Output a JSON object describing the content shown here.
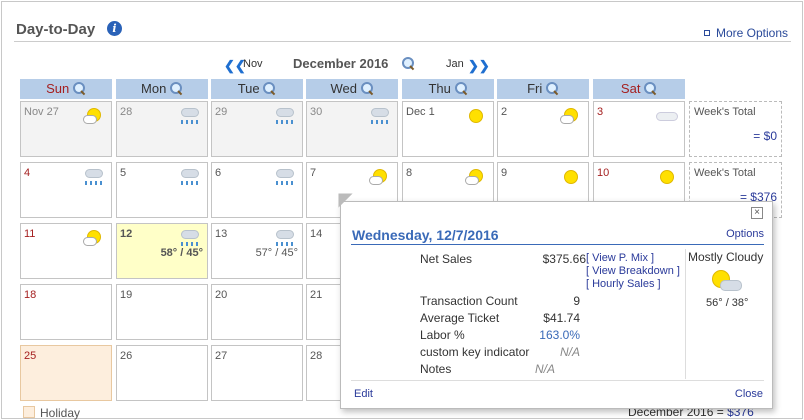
{
  "header": {
    "title": "Day-to-Day",
    "more_options": "More Options"
  },
  "nav": {
    "prev_label": "Nov",
    "month": "December 2016",
    "next_label": "Jan"
  },
  "day_headers": [
    "Sun",
    "Mon",
    "Tue",
    "Wed",
    "Thu",
    "Fri",
    "Sat"
  ],
  "cells": {
    "r0": [
      "Nov 27",
      "28",
      "29",
      "30",
      "Dec 1",
      "2",
      "3"
    ],
    "r1": [
      "4",
      "5",
      "6",
      "7",
      "8",
      "9",
      "10"
    ],
    "r2": [
      "11",
      "12",
      "13",
      "14"
    ],
    "r3": [
      "18",
      "19",
      "20",
      "21"
    ],
    "r4": [
      "25",
      "26",
      "27",
      "28"
    ]
  },
  "temps": {
    "d12": "58° / 45°",
    "d13": "57° / 45°"
  },
  "week_totals": {
    "label": "Week's Total",
    "w1": "= $0",
    "w2": "= $376"
  },
  "legend": {
    "holiday": "Holiday"
  },
  "footer": {
    "month_total_label": "December 2016 =",
    "month_total_value": "$376"
  },
  "popup": {
    "title": "Wednesday, 12/7/2016",
    "options": "Options",
    "net_sales_label": "Net Sales",
    "net_sales_value": "$375.66",
    "link_pmix": "[ View P. Mix ]",
    "link_breakdown": "[ View Breakdown ]",
    "link_hourly": "[ Hourly Sales ]",
    "transaction_count_label": "Transaction Count",
    "transaction_count_value": "9",
    "avg_ticket_label": "Average Ticket",
    "avg_ticket_value": "$41.74",
    "labor_label": "Labor %",
    "labor_value": "163.0%",
    "custom_label": "custom key indicator",
    "custom_value": "N/A",
    "notes_label": "Notes",
    "notes_value": "N/A",
    "weather": "Mostly Cloudy",
    "weather_temps": "56° / 38°",
    "edit": "Edit",
    "close": "Close",
    "close_x": "×"
  },
  "colors": {
    "header_bg": "#b6cde8",
    "weekend_text": "#a52020",
    "link": "#2a3a9a",
    "today_bg": "#ffffc8",
    "holiday_bg": "#fdeedd"
  }
}
